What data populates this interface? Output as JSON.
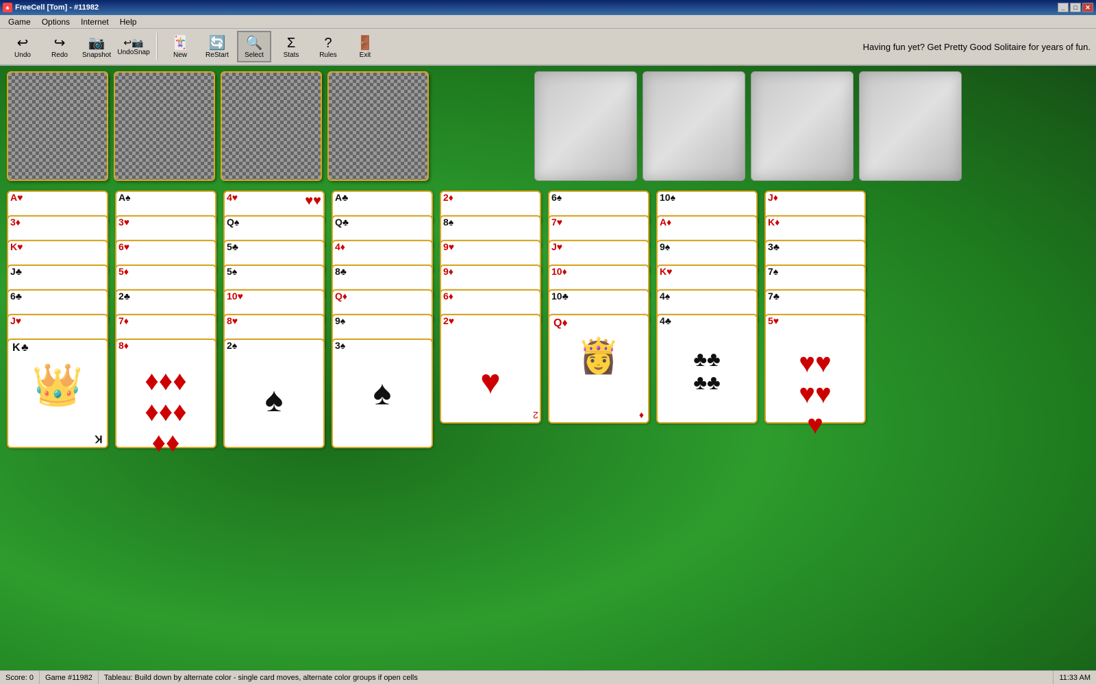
{
  "window": {
    "title": "FreeCell [Tom] - #11982",
    "icon": "♣"
  },
  "titlebar": {
    "controls": [
      "_",
      "□",
      "✕"
    ]
  },
  "menubar": {
    "items": [
      "Game",
      "Options",
      "Internet",
      "Help"
    ]
  },
  "toolbar": {
    "buttons": [
      {
        "label": "Undo",
        "icon": "↩",
        "name": "undo-button"
      },
      {
        "label": "Redo",
        "icon": "↪",
        "name": "redo-button"
      },
      {
        "label": "Snapshot",
        "icon": "📷",
        "name": "snapshot-button"
      },
      {
        "label": "UndoSnap",
        "icon": "↩📷",
        "name": "undosnap-button"
      },
      {
        "label": "New",
        "icon": "🃏",
        "name": "new-button"
      },
      {
        "label": "ReStart",
        "icon": "🔄",
        "name": "restart-button"
      },
      {
        "label": "Select",
        "icon": "🔍",
        "name": "select-button",
        "active": true
      },
      {
        "label": "Stats",
        "icon": "Σ",
        "name": "stats-button"
      },
      {
        "label": "Rules",
        "icon": "?",
        "name": "rules-button"
      },
      {
        "label": "Exit",
        "icon": "🚪",
        "name": "exit-button"
      }
    ]
  },
  "ad": {
    "text": "Having fun yet?  Get Pretty Good Solitaire for years of fun."
  },
  "statusbar": {
    "score": "Score: 0",
    "game": "Game #11982",
    "tableau": "Tableau: Build down by alternate color - single card moves, alternate color groups if open cells",
    "time": "11:33 AM"
  },
  "freecells": [
    {
      "empty": true
    },
    {
      "empty": true
    },
    {
      "empty": true
    },
    {
      "empty": true
    }
  ],
  "foundations": [
    {
      "empty": true
    },
    {
      "empty": true
    },
    {
      "empty": true
    },
    {
      "empty": true
    }
  ],
  "columns": [
    {
      "cards": [
        {
          "rank": "A",
          "suit": "♥",
          "color": "red"
        },
        {
          "rank": "3",
          "suit": "♦",
          "color": "red"
        },
        {
          "rank": "K",
          "suit": "♥",
          "color": "red"
        },
        {
          "rank": "J",
          "suit": "♣",
          "color": "black"
        },
        {
          "rank": "6",
          "suit": "♣",
          "color": "black"
        },
        {
          "rank": "J",
          "suit": "♥",
          "color": "red"
        },
        {
          "rank": "K",
          "suit": "♣",
          "color": "black",
          "face": true
        }
      ]
    },
    {
      "cards": [
        {
          "rank": "A",
          "suit": "♠",
          "color": "black"
        },
        {
          "rank": "3",
          "suit": "♥",
          "color": "red"
        },
        {
          "rank": "6",
          "suit": "♥",
          "color": "red"
        },
        {
          "rank": "5",
          "suit": "♦",
          "color": "red"
        },
        {
          "rank": "2",
          "suit": "♣",
          "color": "black"
        },
        {
          "rank": "7",
          "suit": "♦",
          "color": "red"
        },
        {
          "rank": "8",
          "suit": "♦",
          "color": "red"
        }
      ]
    },
    {
      "cards": [
        {
          "rank": "4",
          "suit": "♥",
          "color": "red"
        },
        {
          "rank": "Q",
          "suit": "♠",
          "color": "black"
        },
        {
          "rank": "5",
          "suit": "♣",
          "color": "black"
        },
        {
          "rank": "5",
          "suit": "♠",
          "color": "black"
        },
        {
          "rank": "10",
          "suit": "♥",
          "color": "red"
        },
        {
          "rank": "8",
          "suit": "♥",
          "color": "red"
        },
        {
          "rank": "2",
          "suit": "♠",
          "color": "black"
        }
      ]
    },
    {
      "cards": [
        {
          "rank": "A",
          "suit": "♣",
          "color": "black"
        },
        {
          "rank": "Q",
          "suit": "♣",
          "color": "black"
        },
        {
          "rank": "4",
          "suit": "♦",
          "color": "red"
        },
        {
          "rank": "8",
          "suit": "♣",
          "color": "black"
        },
        {
          "rank": "Q",
          "suit": "♦",
          "color": "red"
        },
        {
          "rank": "9",
          "suit": "♠",
          "color": "black"
        },
        {
          "rank": "3",
          "suit": "♠",
          "color": "black"
        }
      ]
    },
    {
      "cards": [
        {
          "rank": "2",
          "suit": "♦",
          "color": "red"
        },
        {
          "rank": "8",
          "suit": "♠",
          "color": "black"
        },
        {
          "rank": "9",
          "suit": "♥",
          "color": "red"
        },
        {
          "rank": "9",
          "suit": "♦",
          "color": "red"
        },
        {
          "rank": "6",
          "suit": "♦",
          "color": "red"
        },
        {
          "rank": "2",
          "suit": "♥",
          "color": "red"
        }
      ]
    },
    {
      "cards": [
        {
          "rank": "6",
          "suit": "♠",
          "color": "black"
        },
        {
          "rank": "7",
          "suit": "♥",
          "color": "red"
        },
        {
          "rank": "J",
          "suit": "♥",
          "color": "red"
        },
        {
          "rank": "10",
          "suit": "♦",
          "color": "red"
        },
        {
          "rank": "10",
          "suit": "♣",
          "color": "black"
        },
        {
          "rank": "Q",
          "suit": "♦",
          "color": "red",
          "face": true
        }
      ]
    },
    {
      "cards": [
        {
          "rank": "10",
          "suit": "♠",
          "color": "black"
        },
        {
          "rank": "A",
          "suit": "♦",
          "color": "red"
        },
        {
          "rank": "9",
          "suit": "♠",
          "color": "black"
        },
        {
          "rank": "K",
          "suit": "♥",
          "color": "red"
        },
        {
          "rank": "4",
          "suit": "♠",
          "color": "black"
        },
        {
          "rank": "4",
          "suit": "♣",
          "color": "black"
        }
      ]
    },
    {
      "cards": [
        {
          "rank": "J",
          "suit": "♦",
          "color": "red"
        },
        {
          "rank": "K",
          "suit": "♦",
          "color": "red"
        },
        {
          "rank": "3",
          "suit": "♣",
          "color": "black"
        },
        {
          "rank": "7",
          "suit": "♠",
          "color": "black"
        },
        {
          "rank": "7",
          "suit": "♣",
          "color": "black"
        },
        {
          "rank": "5",
          "suit": "♥",
          "color": "red"
        }
      ]
    }
  ]
}
